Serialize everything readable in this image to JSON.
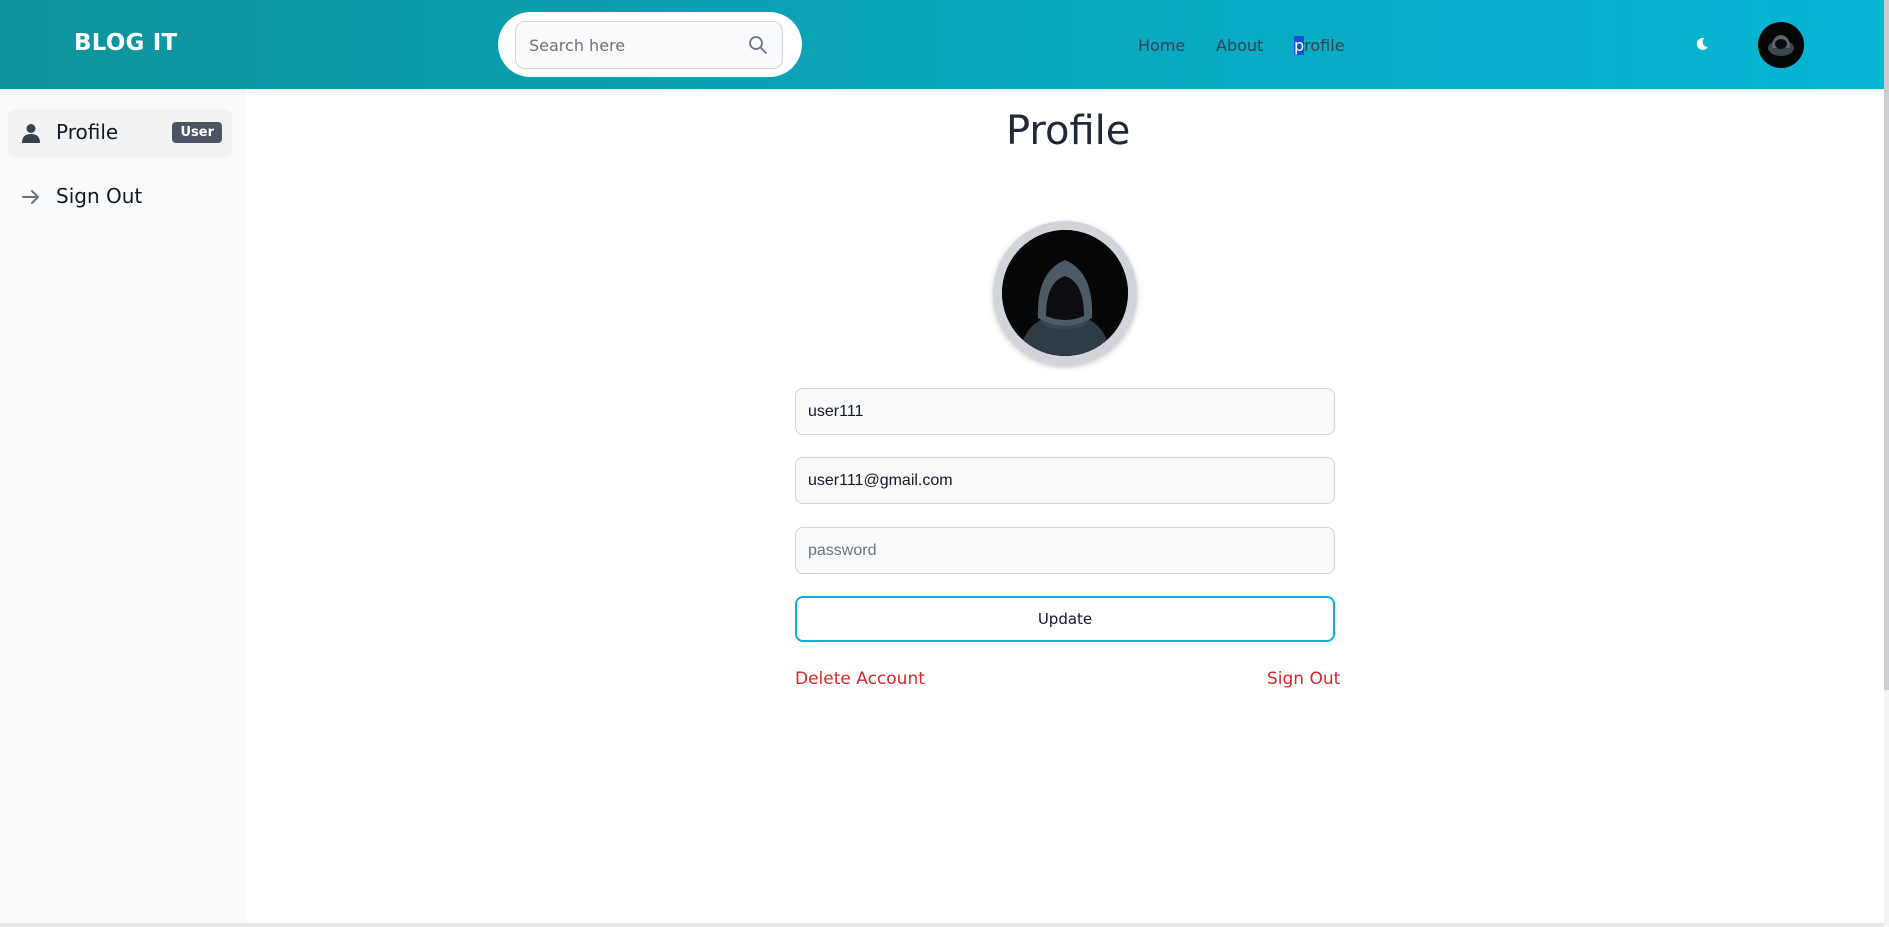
{
  "header": {
    "logo": "BLOG IT",
    "search_placeholder": "Search here",
    "nav": {
      "home": "Home",
      "about": "About",
      "profile_first": "p",
      "profile_rest": "rofile"
    }
  },
  "sidebar": {
    "items": [
      {
        "label": "Profile",
        "badge": "User",
        "icon": "user-icon"
      },
      {
        "label": "Sign Out",
        "icon": "arrow-right-icon"
      }
    ]
  },
  "main": {
    "title": "Profile",
    "username_value": "user111",
    "email_value": "user111@gmail.com",
    "password_placeholder": "password",
    "update_label": "Update",
    "delete_label": "Delete Account",
    "signout_label": "Sign Out"
  },
  "colors": {
    "header_start": "#0e949c",
    "header_end": "#06b6d4",
    "danger": "#dc2626",
    "accent": "#06b6d4"
  }
}
